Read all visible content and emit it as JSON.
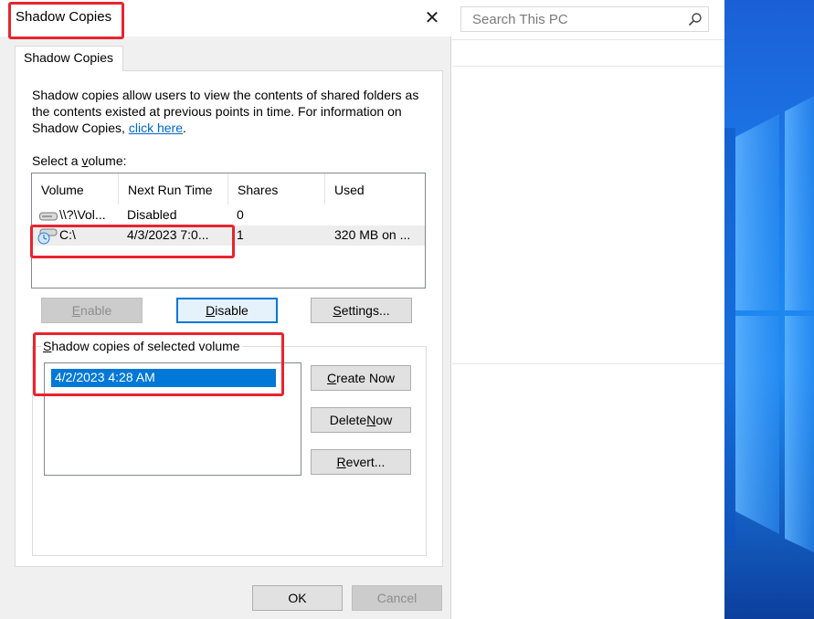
{
  "dialog": {
    "title": "Shadow Copies",
    "tab_label": "Shadow Copies",
    "intro_text": "Shadow copies allow users to view the contents of shared folders as the contents existed at previous points in time. For information on Shadow Copies, ",
    "intro_link": "click here",
    "intro_end": ".",
    "select_label_pre": "Select a ",
    "select_label_u": "v",
    "select_label_post": "olume:",
    "columns": [
      "Volume",
      "Next Run Time",
      "Shares",
      "Used"
    ],
    "rows": [
      {
        "volume": "\\\\?\\Vol...",
        "next_run": "Disabled",
        "shares": "0",
        "used": "",
        "icon": "drive-icon"
      },
      {
        "volume": "C:\\",
        "next_run": "4/3/2023 7:0...",
        "shares": "1",
        "used": "320 MB on ...",
        "icon": "drive-clock-icon"
      }
    ],
    "buttons": {
      "enable_u": "E",
      "enable_rest": "nable",
      "disable_u": "D",
      "disable_rest": "isable",
      "settings_u": "S",
      "settings_rest": "ettings...",
      "create_u": "C",
      "create_rest": "reate Now",
      "delete_pre": "Delete ",
      "delete_u": "N",
      "delete_rest": "ow",
      "revert_u": "R",
      "revert_rest": "evert...",
      "ok": "OK",
      "cancel": "Cancel"
    },
    "group_label_u": "S",
    "group_label_rest": "hadow copies of selected volume",
    "copies": [
      "4/2/2023 4:28 AM"
    ]
  },
  "explorer": {
    "search_placeholder": "Search This PC"
  },
  "colors": {
    "accent": "#0078d7",
    "highlight": "#e8242f",
    "link": "#0066cc"
  }
}
